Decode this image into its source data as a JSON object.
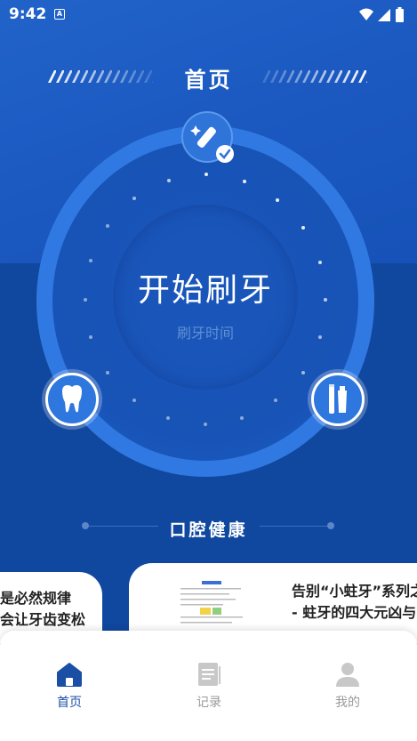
{
  "status_bar": {
    "time": "9:42",
    "notification_letter": "A"
  },
  "header": {
    "title": "首页"
  },
  "brush": {
    "start_label": "开始刷牙",
    "subtitle": "刷牙时间"
  },
  "section": {
    "title": "口腔健康"
  },
  "articles": [
    {
      "lines": [
        "是必然规律",
        "会让牙齿变松"
      ]
    },
    {
      "lines": [
        "告别“小蛀牙”系列之",
        "- 蛀牙的四大元凶与"
      ]
    }
  ],
  "nav": {
    "items": [
      {
        "label": "首页",
        "icon": "home-icon",
        "active": true
      },
      {
        "label": "记录",
        "icon": "record-icon",
        "active": false
      },
      {
        "label": "我的",
        "icon": "profile-icon",
        "active": false
      }
    ]
  },
  "colors": {
    "primary": "#1a57bf",
    "ring": "#3079e2",
    "active_nav": "#1a4fa5",
    "inactive_nav": "#9a9a9a"
  }
}
